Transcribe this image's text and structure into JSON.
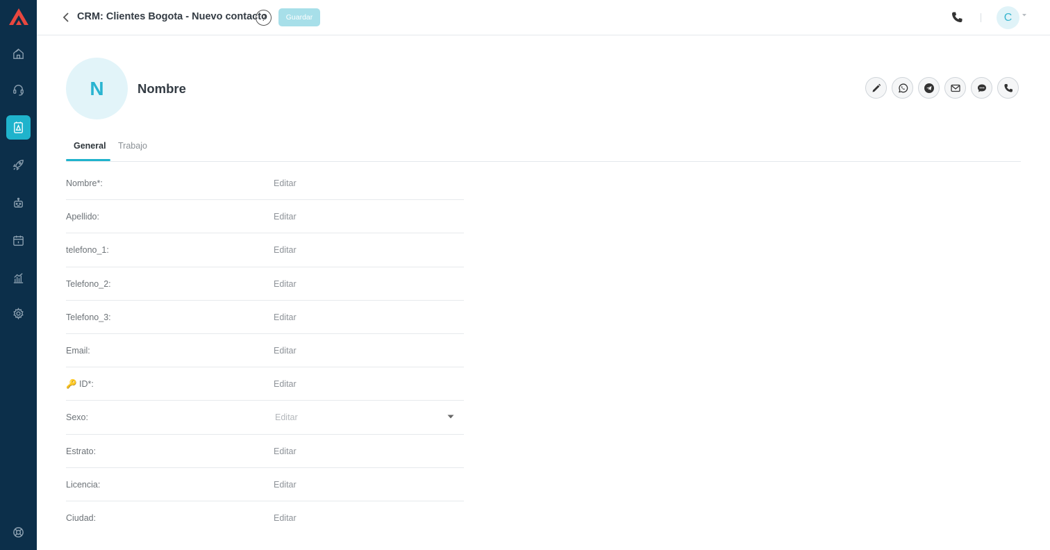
{
  "header": {
    "title": "CRM: Clientes Bogota - Nuevo contacto",
    "help_label": "?",
    "save_label": "Guardar",
    "user_initial": "C"
  },
  "contact": {
    "initial": "N",
    "name": "Nombre"
  },
  "tabs": [
    {
      "label": "General",
      "active": true
    },
    {
      "label": "Trabajo",
      "active": false
    }
  ],
  "form": {
    "rows": [
      {
        "label": "Nombre*:",
        "placeholder": "Editar"
      },
      {
        "label": "Apellido:",
        "placeholder": "Editar"
      },
      {
        "label": "telefono_1:",
        "placeholder": "Editar"
      },
      {
        "label": "Telefono_2:",
        "placeholder": "Editar"
      },
      {
        "label": "Telefono_3:",
        "placeholder": "Editar"
      },
      {
        "label": "Email:",
        "placeholder": "Editar"
      },
      {
        "label": "🔑 ID*:",
        "placeholder": "Editar"
      },
      {
        "label": "Sexo:",
        "placeholder": "Editar",
        "type": "select"
      },
      {
        "label": "Estrato:",
        "placeholder": "Editar"
      },
      {
        "label": "Licencia:",
        "placeholder": "Editar"
      },
      {
        "label": "Ciudad:",
        "placeholder": "Editar"
      }
    ]
  },
  "colors": {
    "sidebar_bg": "#0c2f4a",
    "accent": "#1fb3cc",
    "save_button_bg": "#a7dfe9",
    "logo": "#e8473f"
  },
  "icons": {
    "sidebar": [
      "home-icon",
      "headset-icon",
      "contacts-book-icon",
      "rocket-icon",
      "robot-icon",
      "calendar-icon",
      "bar-chart-icon",
      "gear-icon",
      "lifebuoy-icon"
    ],
    "actions": [
      "pencil-icon",
      "whatsapp-icon",
      "telegram-icon",
      "mail-icon",
      "chat-bubble-icon",
      "phone-icon"
    ]
  }
}
